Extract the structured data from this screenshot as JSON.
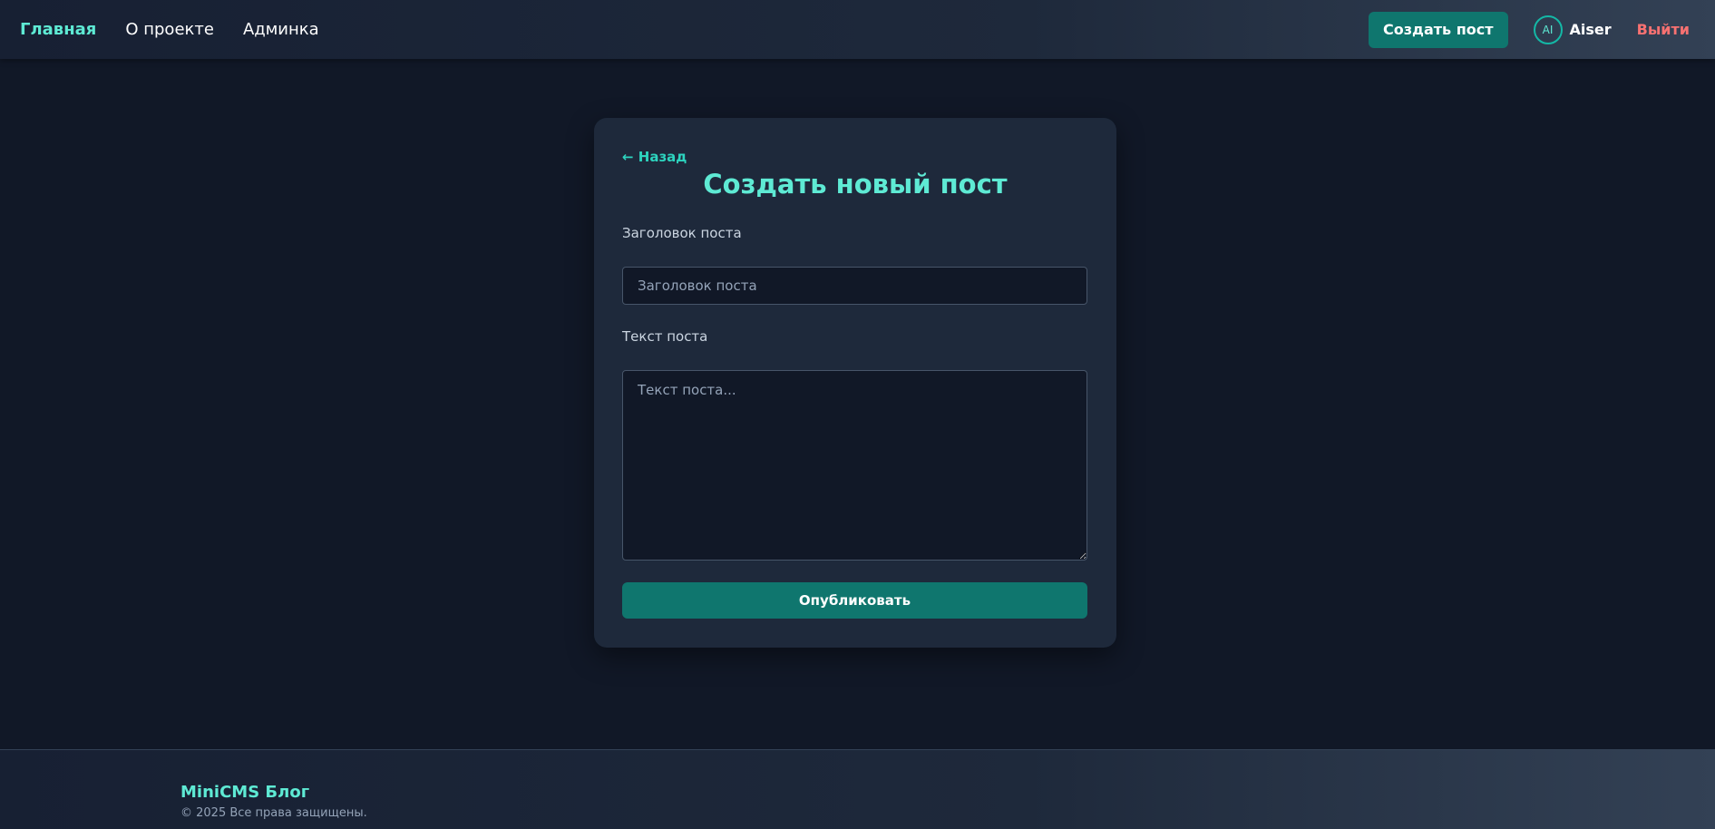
{
  "header": {
    "nav": [
      {
        "label": "Главная"
      },
      {
        "label": "О проекте"
      },
      {
        "label": "Админка"
      }
    ],
    "create_post_label": "Создать пост",
    "user": {
      "avatar_initials": "AI",
      "name": "Aiser"
    },
    "logout_label": "Выйти"
  },
  "form": {
    "back_label": "← Назад",
    "title": "Создать новый пост",
    "post_title_label": "Заголовок поста",
    "post_title_placeholder": "Заголовок поста",
    "post_title_value": "",
    "post_body_label": "Текст поста",
    "post_body_placeholder": "Текст поста...",
    "post_body_value": "",
    "submit_label": "Опубликовать"
  },
  "footer": {
    "brand": "MiniCMS Блог",
    "copyright": "© 2025 Все права защищены."
  },
  "colors": {
    "accent": "#5eead4",
    "button": "#0f766e",
    "logout": "#f87171",
    "background": "#111827",
    "card": "#1e293b"
  }
}
